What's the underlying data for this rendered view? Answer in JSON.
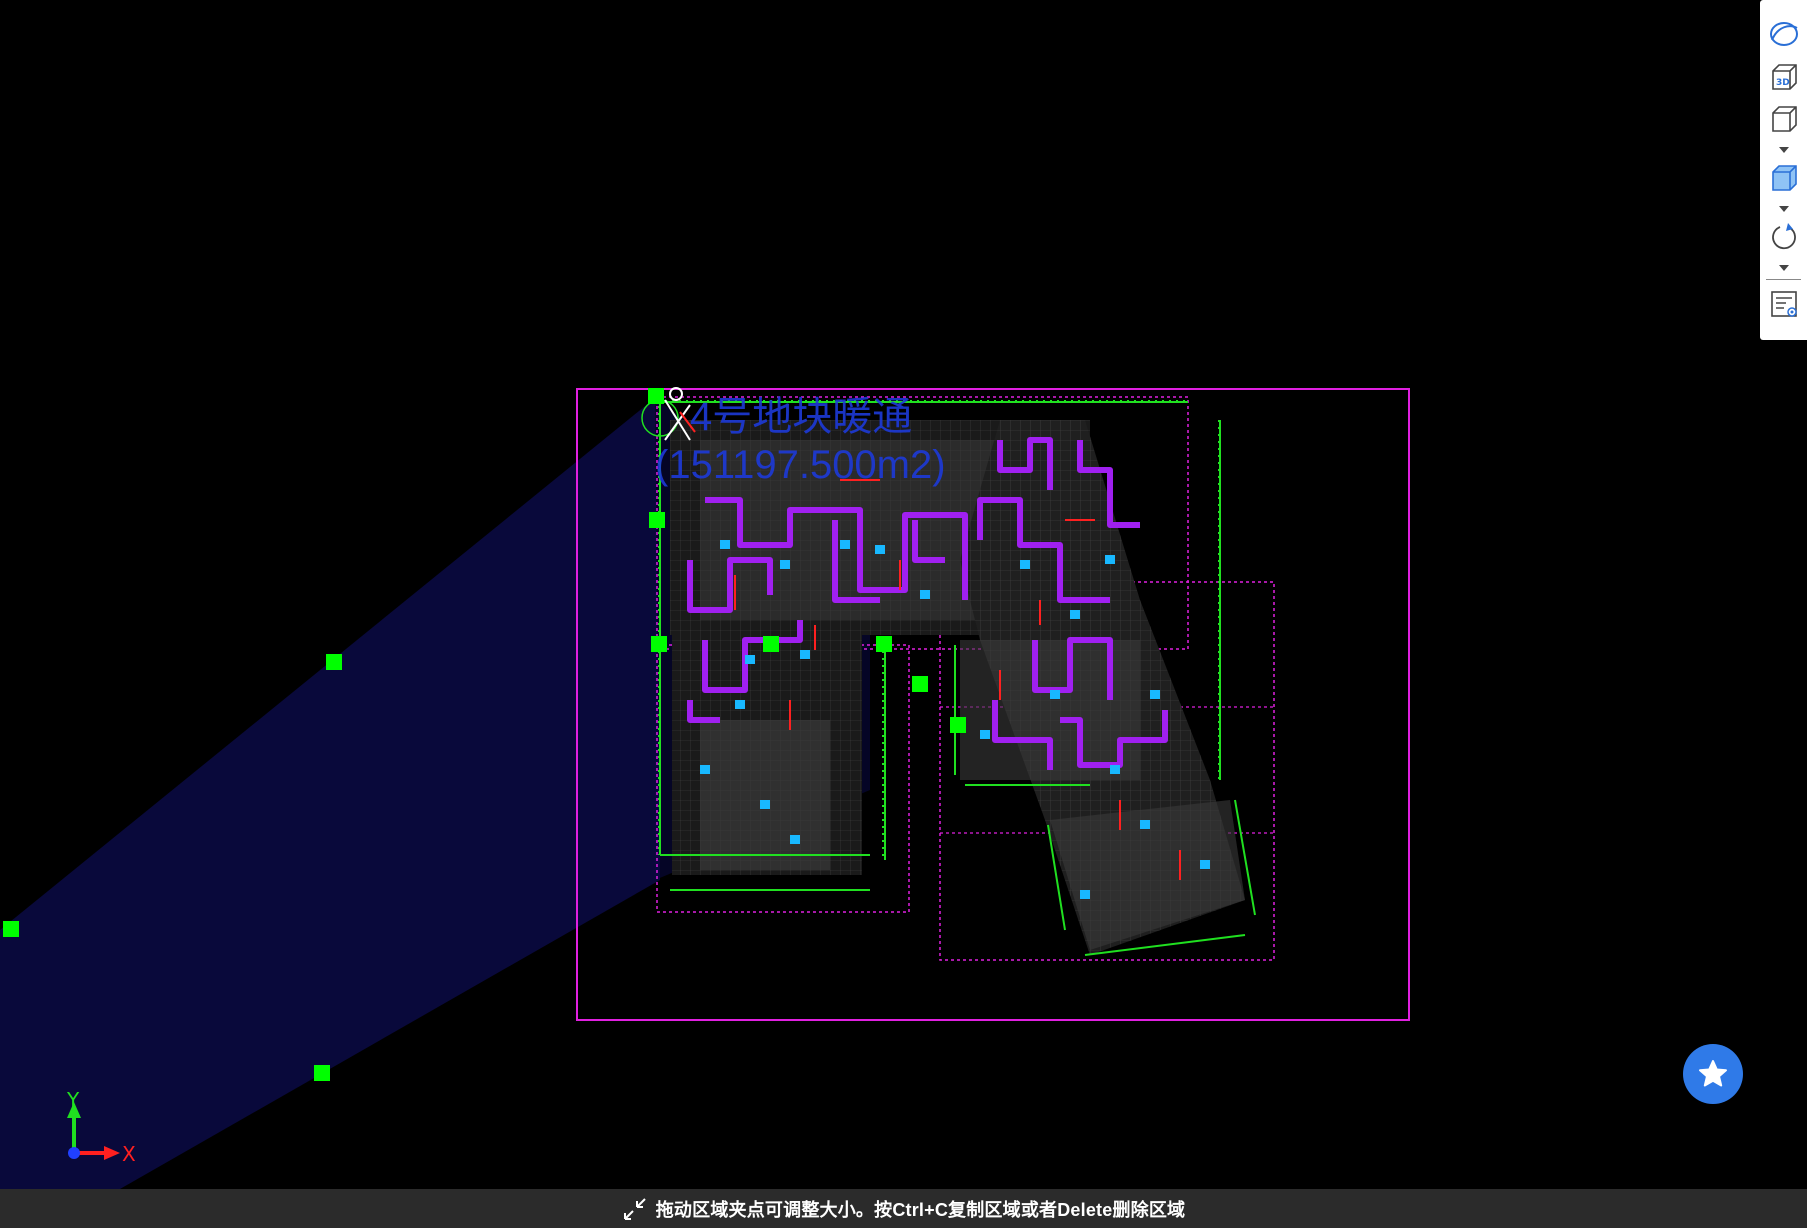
{
  "drawing": {
    "region_title": "4号地块暖通",
    "region_area": "(151197.500m2)"
  },
  "axes": {
    "x_label": "X",
    "y_label": "Y"
  },
  "toolbar": {
    "items": [
      {
        "name": "orbit-icon"
      },
      {
        "name": "3d-view-icon"
      },
      {
        "name": "wireframe-cube-icon"
      },
      {
        "name": "solid-cube-icon"
      },
      {
        "name": "rotate-icon"
      },
      {
        "name": "properties-panel-icon"
      }
    ]
  },
  "statusbar": {
    "hint": "拖动区域夹点可调整大小。按Ctrl+C复制区域或者Delete删除区域"
  },
  "colors": {
    "background": "#000000",
    "region_border": "#e020e0",
    "grip": "#00ff00",
    "title_text": "#1d3ad8",
    "fab": "#2f7ae8",
    "statusbar": "#2b2b2b",
    "duct_purple": "#a020f0",
    "grid_green": "#20e020"
  }
}
